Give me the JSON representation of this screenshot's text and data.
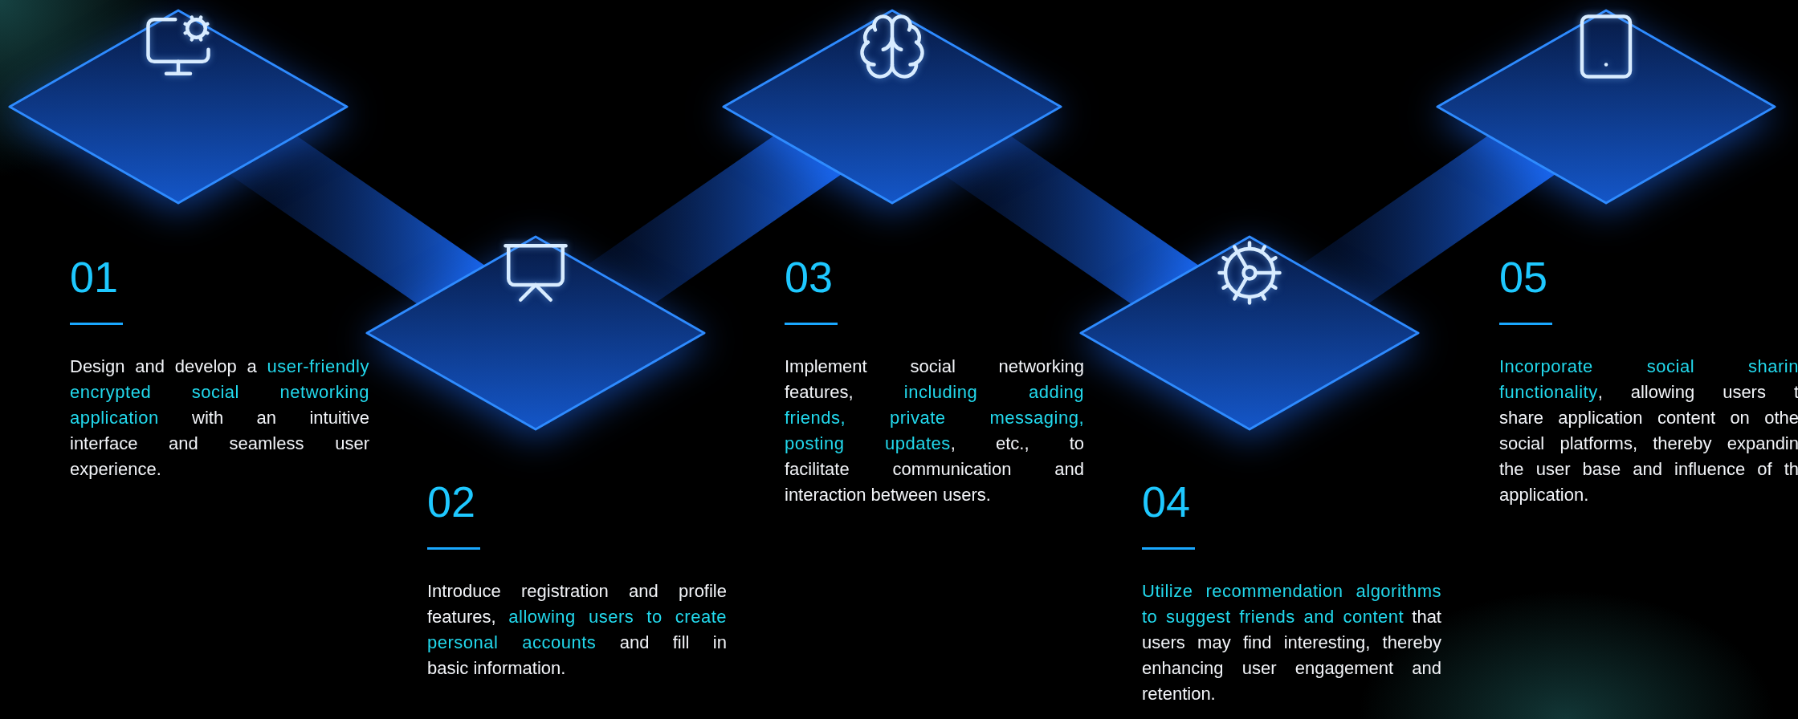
{
  "steps": [
    {
      "number": "01",
      "lines": [
        [
          {
            "text": "Design and develop a ",
            "highlight": false
          },
          {
            "text": "user-friendly",
            "highlight": true
          }
        ],
        [
          {
            "text": "encrypted social networking",
            "highlight": true
          }
        ],
        [
          {
            "text": "application",
            "highlight": true
          },
          {
            "text": " with an intuitive",
            "highlight": false
          }
        ],
        [
          {
            "text": "interface and seamless user",
            "highlight": false
          }
        ],
        [
          {
            "text": "experience.",
            "highlight": false
          }
        ]
      ]
    },
    {
      "number": "02",
      "lines": [
        [
          {
            "text": "Introduce registration and profile",
            "highlight": false
          }
        ],
        [
          {
            "text": "features, ",
            "highlight": false
          },
          {
            "text": "allowing users to create",
            "highlight": true
          }
        ],
        [
          {
            "text": "personal accounts",
            "highlight": true
          },
          {
            "text": " and fill in",
            "highlight": false
          }
        ],
        [
          {
            "text": "basic information.",
            "highlight": false
          }
        ]
      ]
    },
    {
      "number": "03",
      "lines": [
        [
          {
            "text": "Implement social networking",
            "highlight": false
          }
        ],
        [
          {
            "text": "features, ",
            "highlight": false
          },
          {
            "text": "including adding",
            "highlight": true
          }
        ],
        [
          {
            "text": "friends, private messaging,",
            "highlight": true
          }
        ],
        [
          {
            "text": "posting updates",
            "highlight": true
          },
          {
            "text": ", etc., to",
            "highlight": false
          }
        ],
        [
          {
            "text": "facilitate communication and",
            "highlight": false
          }
        ],
        [
          {
            "text": "interaction between users.",
            "highlight": false
          }
        ]
      ]
    },
    {
      "number": "04",
      "lines": [
        [
          {
            "text": "Utilize recommendation algorithms",
            "highlight": true
          }
        ],
        [
          {
            "text": "to suggest friends and content",
            "highlight": true
          },
          {
            "text": " that",
            "highlight": false
          }
        ],
        [
          {
            "text": "users may find interesting, thereby",
            "highlight": false
          }
        ],
        [
          {
            "text": "enhancing user engagement and",
            "highlight": false
          }
        ],
        [
          {
            "text": "retention.",
            "highlight": false
          }
        ]
      ]
    },
    {
      "number": "05",
      "lines": [
        [
          {
            "text": "Incorporate social sharin",
            "highlight": true
          }
        ],
        [
          {
            "text": "functionality",
            "highlight": true
          },
          {
            "text": ", allowing users t",
            "highlight": false
          }
        ],
        [
          {
            "text": "share application content on othe",
            "highlight": false
          }
        ],
        [
          {
            "text": "social platforms, thereby expandin",
            "highlight": false
          }
        ],
        [
          {
            "text": "the user base and influence of th",
            "highlight": false
          }
        ],
        [
          {
            "text": "application.",
            "highlight": false
          }
        ]
      ]
    }
  ]
}
